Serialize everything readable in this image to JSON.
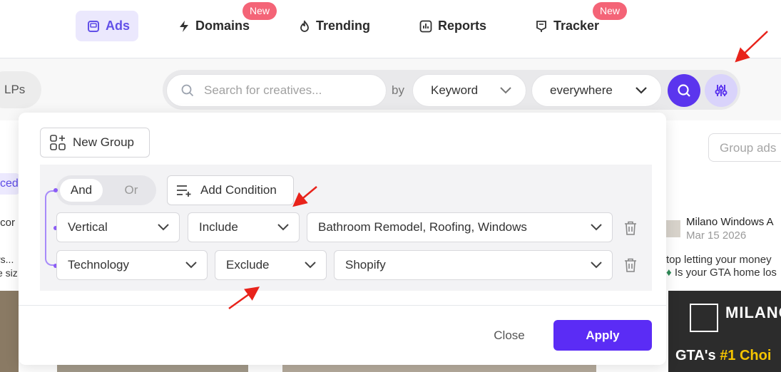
{
  "nav": {
    "items": [
      {
        "label": "Ads",
        "icon": "ads-icon",
        "active": true
      },
      {
        "label": "Domains",
        "icon": "bolt-icon",
        "badge": "New"
      },
      {
        "label": "Trending",
        "icon": "fire-icon"
      },
      {
        "label": "Reports",
        "icon": "chart-icon"
      },
      {
        "label": "Tracker",
        "icon": "tracker-icon",
        "badge": "New"
      }
    ]
  },
  "searchbar": {
    "lps_label": "LPs",
    "placeholder": "Search for creatives...",
    "by_label": "by",
    "field_selected": "Keyword",
    "scope_selected": "everywhere"
  },
  "background": {
    "group_ads_placeholder": "Group ads",
    "left_tab_fragment": "ced",
    "left_domain_fragment": ".cor",
    "left_text_line1": "rs...",
    "left_text_line2": "e siz",
    "advertiser": "Milano Windows A",
    "date": "Mar 15 2026",
    "ad_text_line1": "top letting your money",
    "ad_text_line2": "Is your GTA home los",
    "brand_name": "MILANO",
    "brand_tagline_prefix": "GTA's",
    "brand_tagline_highlight": "#1 Choi"
  },
  "filter_popup": {
    "new_group_label": "New Group",
    "logic_and": "And",
    "logic_or": "Or",
    "add_condition_label": "Add Condition",
    "conditions": [
      {
        "field": "Vertical",
        "operator": "Include",
        "value": "Bathroom Remodel, Roofing, Windows"
      },
      {
        "field": "Technology",
        "operator": "Exclude",
        "value": "Shopify"
      }
    ],
    "close_label": "Close",
    "apply_label": "Apply"
  },
  "colors": {
    "accent": "#5b2cf5",
    "nav_active_bg": "#ebe8fd",
    "badge": "#f46477",
    "annotation_arrow": "#e8231b"
  }
}
